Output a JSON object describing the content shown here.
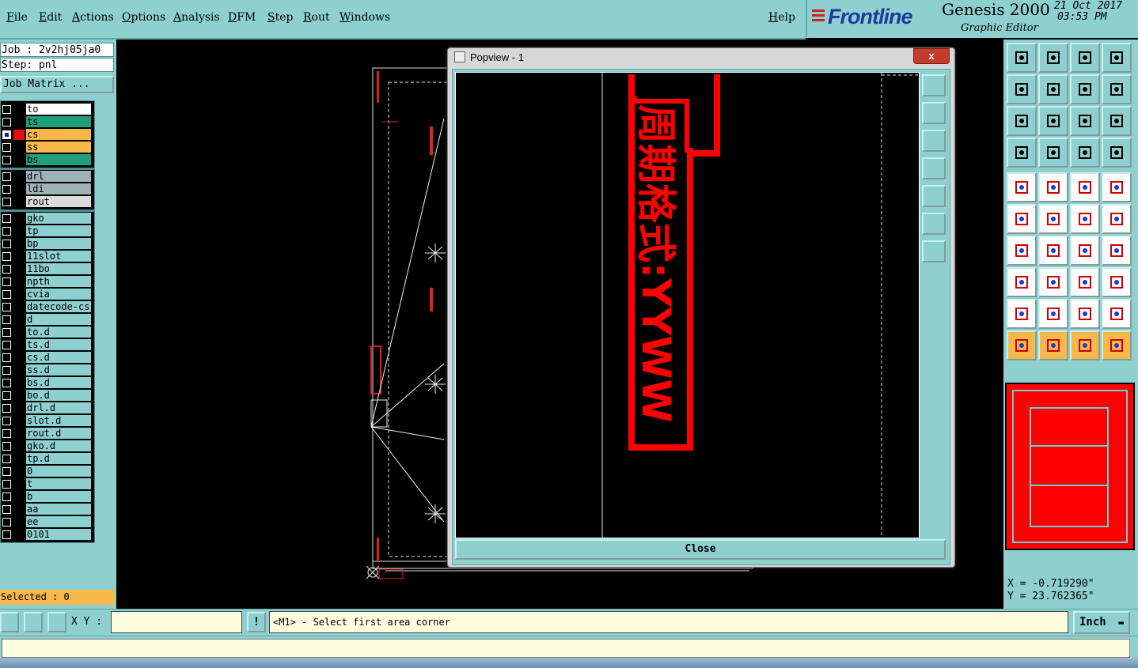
{
  "menu": {
    "items": [
      "File",
      "Edit",
      "Actions",
      "Options",
      "Analysis",
      "DFM",
      "Step",
      "Rout",
      "Windows"
    ],
    "help": "Help"
  },
  "brand": {
    "logo": "Frontline",
    "product": "Genesis 2000",
    "subtitle": "Graphic Editor",
    "date": "21 Oct 2017",
    "time": "03:53 PM"
  },
  "job": {
    "job_line": "Job : 2v2hj05ja0",
    "step_line": "Step: pnl",
    "matrix_button": "Job Matrix ..."
  },
  "layers": {
    "group1": [
      {
        "name": "to",
        "color": "#ffffff",
        "mark": "#000000",
        "selected": false
      },
      {
        "name": "ts",
        "color": "#1fa07a",
        "mark": "#000000",
        "selected": false
      },
      {
        "name": "cs",
        "color": "#f7b84a",
        "mark": "#e01010",
        "selected": true
      },
      {
        "name": "ss",
        "color": "#f7b84a",
        "mark": "#000000",
        "selected": false
      },
      {
        "name": "bs",
        "color": "#1fa07a",
        "mark": "#000000",
        "selected": false
      }
    ],
    "group2": [
      {
        "name": "drl",
        "color": "#9fb2ba",
        "mark": "#000000",
        "selected": false
      },
      {
        "name": "ldi",
        "color": "#9fb2ba",
        "mark": "#000000",
        "selected": false
      },
      {
        "name": "rout",
        "color": "#dcdcdc",
        "mark": "#000000",
        "selected": false
      }
    ],
    "group3": [
      "gko",
      "tp",
      "bp",
      "11slot",
      "11bo",
      "npth",
      "cvia",
      "datecode-cs",
      "d",
      "to.d",
      "ts.d",
      "cs.d",
      "ss.d",
      "bs.d",
      "bo.d",
      "drl.d",
      "slot.d",
      "rout.d",
      "gko.d",
      "tp.d",
      "0",
      "t",
      "b",
      "aa",
      "ee",
      "0101"
    ],
    "group3_color": "#8ed0cf"
  },
  "selected_label": "Selected : 0",
  "popview": {
    "title": "Popview - 1",
    "close_x": "x",
    "close_button": "Close",
    "text_label": "周期格式:YYWW"
  },
  "coords": {
    "x": "X = -0.719290\"",
    "y": "Y = 23.762365\""
  },
  "bottom": {
    "xy_label": "X Y :",
    "xy_value": "",
    "alert_glyph": "!",
    "message": "<M1> - Select first area corner",
    "unit": "Inch"
  },
  "colors": {
    "panel": "#8ed0cf",
    "accent_red": "#ff0000",
    "highlight": "#f7b84a",
    "cyan_line": "#5fd3d0"
  }
}
